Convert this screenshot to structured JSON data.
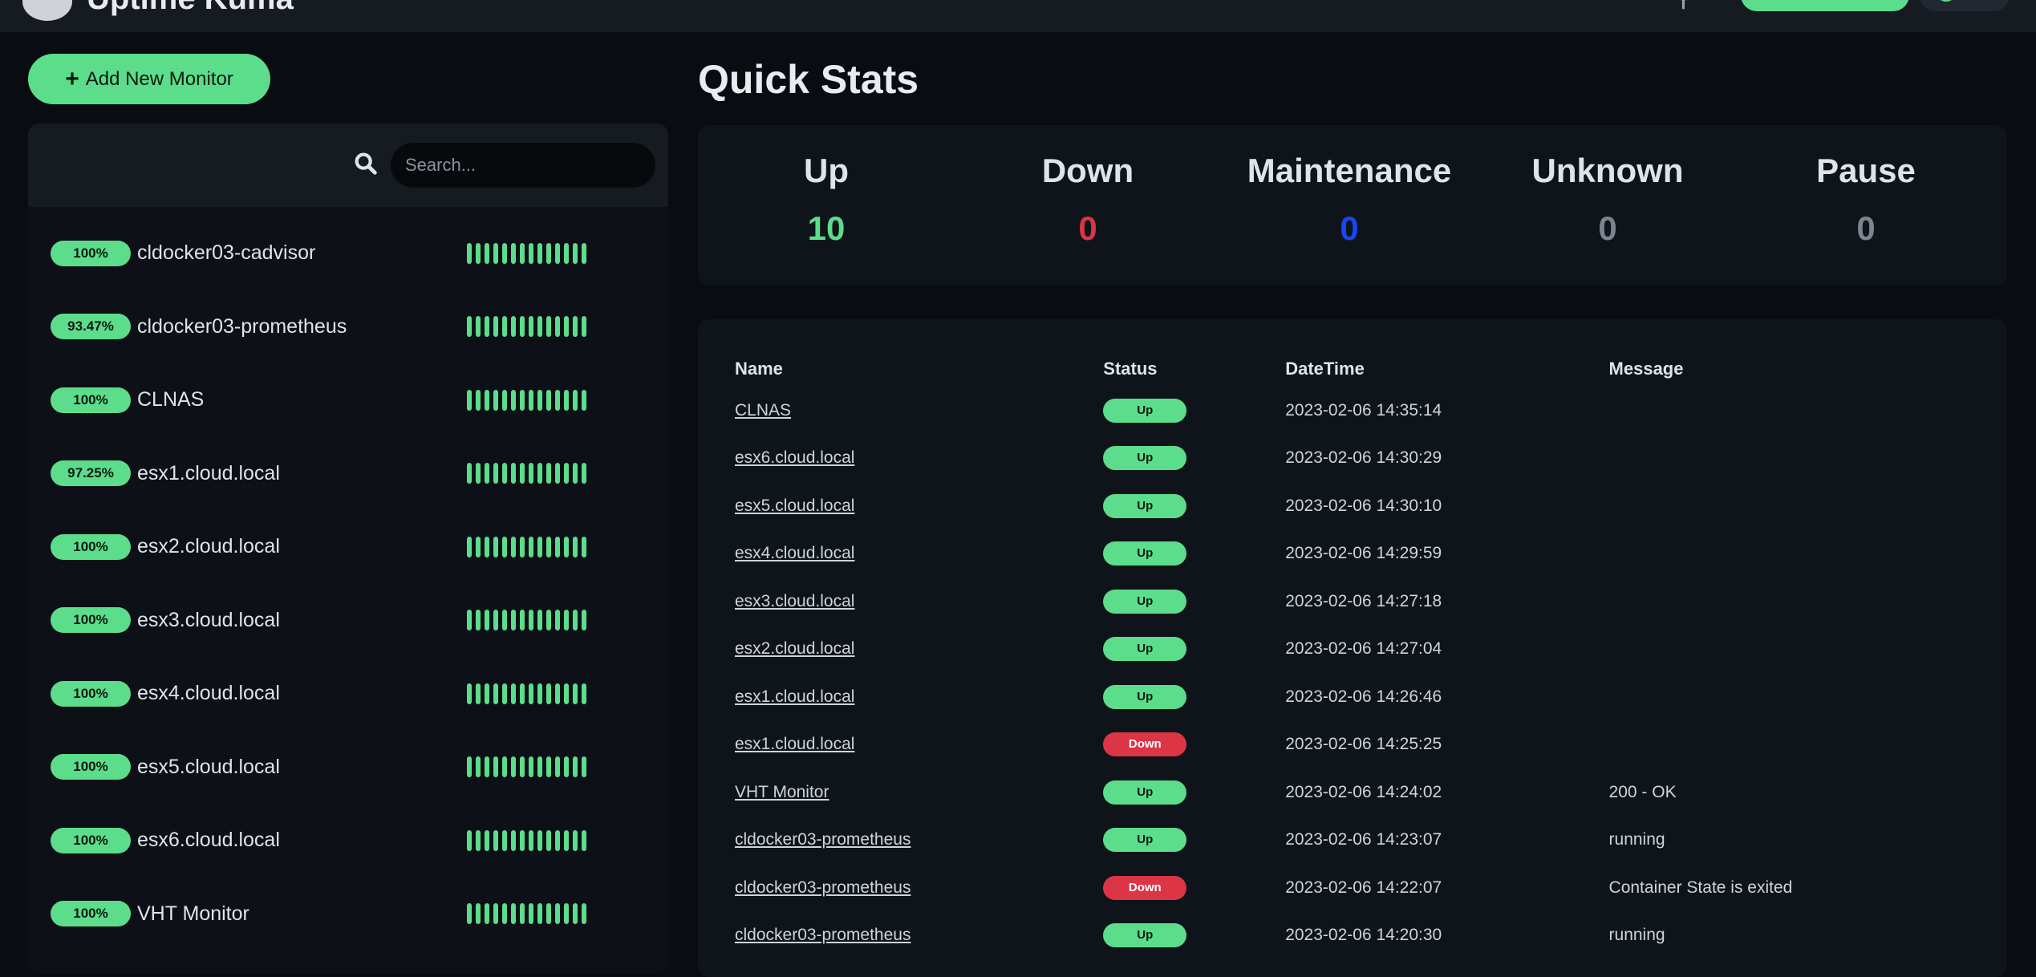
{
  "header": {
    "title": "Uptime Kuma",
    "profile_icon": "user-avatar"
  },
  "sidebar": {
    "add_button_label": "Add New Monitor",
    "search": {
      "placeholder": "Search...",
      "value": ""
    },
    "monitors": [
      {
        "uptime": "100%",
        "name": "cldocker03-cadvisor"
      },
      {
        "uptime": "93.47%",
        "name": "cldocker03-prometheus"
      },
      {
        "uptime": "100%",
        "name": "CLNAS"
      },
      {
        "uptime": "97.25%",
        "name": "esx1.cloud.local"
      },
      {
        "uptime": "100%",
        "name": "esx2.cloud.local"
      },
      {
        "uptime": "100%",
        "name": "esx3.cloud.local"
      },
      {
        "uptime": "100%",
        "name": "esx4.cloud.local"
      },
      {
        "uptime": "100%",
        "name": "esx5.cloud.local"
      },
      {
        "uptime": "100%",
        "name": "esx6.cloud.local"
      },
      {
        "uptime": "100%",
        "name": "VHT Monitor"
      },
      {
        "uptime": "",
        "name": ""
      }
    ],
    "beat_color": "#5cdd8b"
  },
  "main": {
    "title": "Quick Stats",
    "stats": [
      {
        "label": "Up",
        "value": "10",
        "color": "#5cdd8b"
      },
      {
        "label": "Down",
        "value": "0",
        "color": "#dc3545"
      },
      {
        "label": "Maintenance",
        "value": "0",
        "color": "#1747f5"
      },
      {
        "label": "Unknown",
        "value": "0",
        "color": "#7d848d"
      },
      {
        "label": "Pause",
        "value": "0",
        "color": "#7d848d"
      }
    ],
    "table": {
      "headers": {
        "name": "Name",
        "status": "Status",
        "datetime": "DateTime",
        "message": "Message"
      },
      "rows": [
        {
          "name": "CLNAS",
          "status": "Up",
          "datetime": "2023-02-06 14:35:14",
          "message": ""
        },
        {
          "name": "esx6.cloud.local",
          "status": "Up",
          "datetime": "2023-02-06 14:30:29",
          "message": ""
        },
        {
          "name": "esx5.cloud.local",
          "status": "Up",
          "datetime": "2023-02-06 14:30:10",
          "message": ""
        },
        {
          "name": "esx4.cloud.local",
          "status": "Up",
          "datetime": "2023-02-06 14:29:59",
          "message": ""
        },
        {
          "name": "esx3.cloud.local",
          "status": "Up",
          "datetime": "2023-02-06 14:27:18",
          "message": ""
        },
        {
          "name": "esx2.cloud.local",
          "status": "Up",
          "datetime": "2023-02-06 14:27:04",
          "message": ""
        },
        {
          "name": "esx1.cloud.local",
          "status": "Up",
          "datetime": "2023-02-06 14:26:46",
          "message": ""
        },
        {
          "name": "esx1.cloud.local",
          "status": "Down",
          "datetime": "2023-02-06 14:25:25",
          "message": ""
        },
        {
          "name": "VHT Monitor",
          "status": "Up",
          "datetime": "2023-02-06 14:24:02",
          "message": "200 - OK"
        },
        {
          "name": "cldocker03-prometheus",
          "status": "Up",
          "datetime": "2023-02-06 14:23:07",
          "message": "running"
        },
        {
          "name": "cldocker03-prometheus",
          "status": "Down",
          "datetime": "2023-02-06 14:22:07",
          "message": "Container State is exited"
        },
        {
          "name": "cldocker03-prometheus",
          "status": "Up",
          "datetime": "2023-02-06 14:20:30",
          "message": "running"
        }
      ]
    }
  }
}
